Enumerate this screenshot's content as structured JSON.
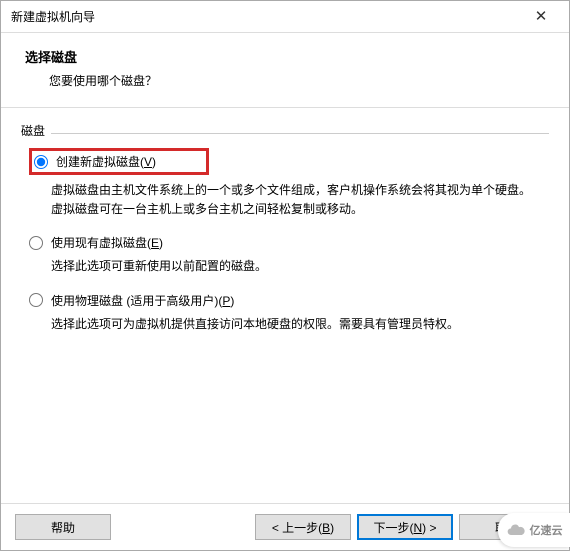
{
  "window": {
    "title": "新建虚拟机向导",
    "close": "✕"
  },
  "header": {
    "heading": "选择磁盘",
    "subheading": "您要使用哪个磁盘？"
  },
  "group": {
    "label": "磁盘"
  },
  "options": [
    {
      "label_pre": "创建新虚拟磁盘(",
      "label_key": "V",
      "label_post": ")",
      "desc": "虚拟磁盘由主机文件系统上的一个或多个文件组成，客户机操作系统会将其视为单个硬盘。虚拟磁盘可在一台主机上或多台主机之间轻松复制或移动。",
      "selected": true,
      "highlight": true
    },
    {
      "label_pre": "使用现有虚拟磁盘(",
      "label_key": "E",
      "label_post": ")",
      "desc": "选择此选项可重新使用以前配置的磁盘。",
      "selected": false,
      "highlight": false
    },
    {
      "label_pre": "使用物理磁盘 (适用于高级用户)(",
      "label_key": "P",
      "label_post": ")",
      "desc": "选择此选项可为虚拟机提供直接访问本地硬盘的权限。需要具有管理员特权。",
      "selected": false,
      "highlight": false
    }
  ],
  "footer": {
    "help": "帮助",
    "back_pre": "< 上一步(",
    "back_key": "B",
    "back_post": ")",
    "next_pre": "下一步(",
    "next_key": "N",
    "next_post": ") >",
    "cancel": "取消"
  },
  "watermark": "亿速云"
}
